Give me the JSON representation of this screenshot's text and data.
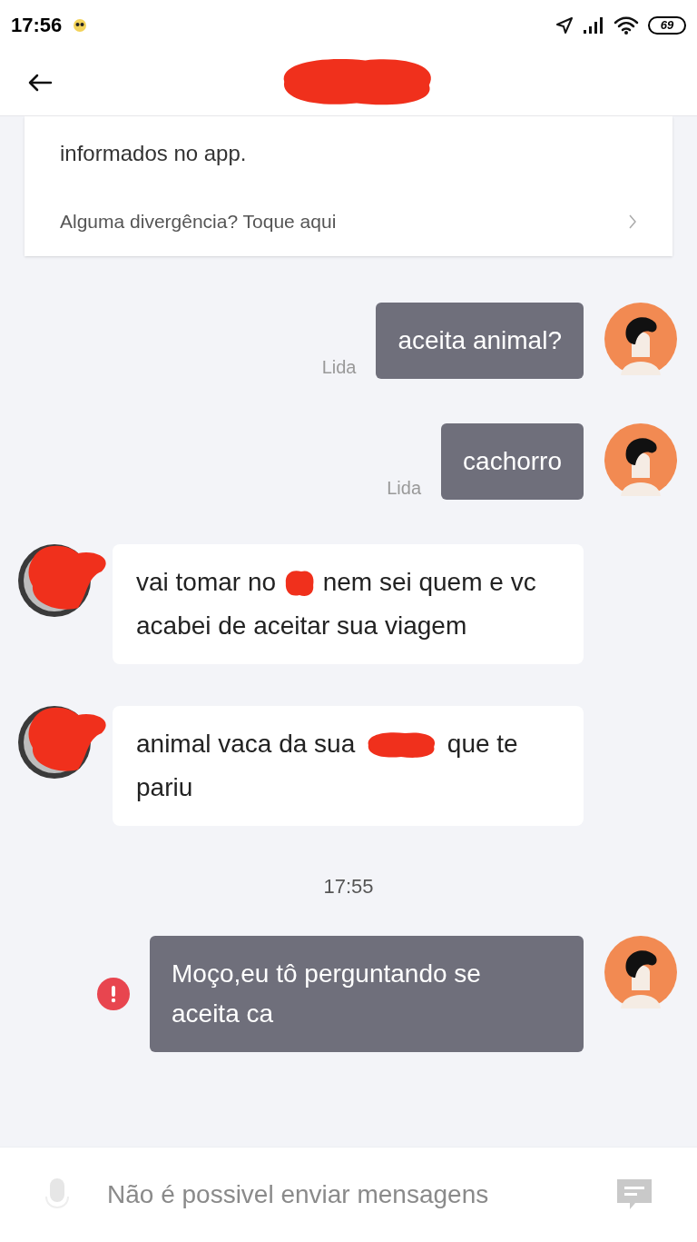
{
  "status_bar": {
    "time": "17:56",
    "battery": "69"
  },
  "header": {
    "title_redacted": true
  },
  "card": {
    "text": "informados no app.",
    "link": "Alguma divergência? Toque aqui"
  },
  "messages": [
    {
      "kind": "sent",
      "text": "aceita animal?",
      "receipt": "Lida",
      "failed": false
    },
    {
      "kind": "sent",
      "text": "cachorro",
      "receipt": "Lida",
      "failed": false
    },
    {
      "kind": "received",
      "before": "vai tomar no",
      "after": "nem sei quem e vc acabei de aceitar sua viagem"
    },
    {
      "kind": "received",
      "before": "animal vaca da sua",
      "after": "que te pariu"
    },
    {
      "kind": "time",
      "text": "17:55"
    },
    {
      "kind": "sent",
      "text": "Moço,eu tô perguntando se aceita ca",
      "failed": true
    }
  ],
  "input": {
    "placeholder": "Não é possivel enviar mensagens",
    "disabled": true
  }
}
